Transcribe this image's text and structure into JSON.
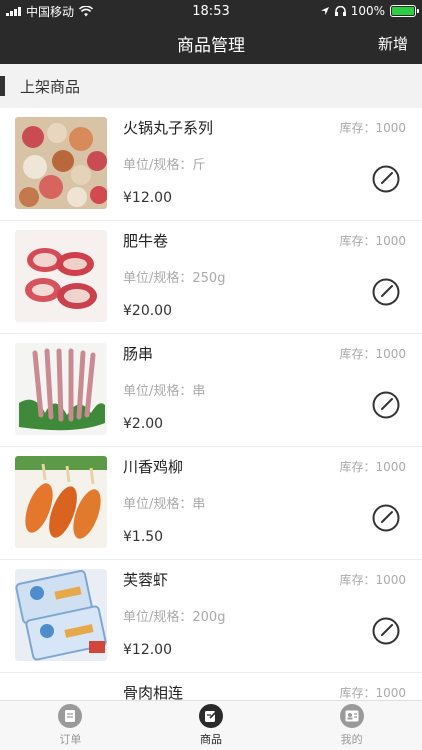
{
  "status": {
    "carrier": "中国移动",
    "time": "18:53",
    "battery": "100%"
  },
  "nav": {
    "title": "商品管理",
    "add": "新增"
  },
  "section": {
    "label": "上架商品"
  },
  "products": [
    {
      "name": "火锅丸子系列",
      "stock": "库存：1000",
      "unit": "单位/规格：斤",
      "price": "¥12.00"
    },
    {
      "name": "肥牛卷",
      "stock": "库存：1000",
      "unit": "单位/规格：250g",
      "price": "¥20.00"
    },
    {
      "name": "肠串",
      "stock": "库存：1000",
      "unit": "单位/规格：串",
      "price": "¥2.00"
    },
    {
      "name": "川香鸡柳",
      "stock": "库存：1000",
      "unit": "单位/规格：串",
      "price": "¥1.50"
    },
    {
      "name": "芙蓉虾",
      "stock": "库存：1000",
      "unit": "单位/规格：200g",
      "price": "¥12.00"
    },
    {
      "name": "骨肉相连",
      "stock": "库存：1000",
      "unit": "",
      "price": ""
    }
  ],
  "tabs": [
    {
      "label": "订单"
    },
    {
      "label": "商品"
    },
    {
      "label": "我的"
    }
  ]
}
